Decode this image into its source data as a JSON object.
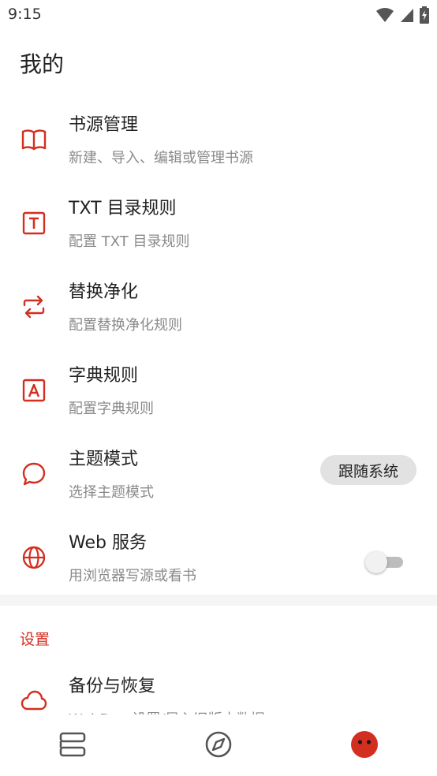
{
  "status_bar": {
    "time": "9:15"
  },
  "page": {
    "title": "我的"
  },
  "items": [
    {
      "title": "书源管理",
      "subtitle": "新建、导入、编辑或管理书源"
    },
    {
      "title": "TXT 目录规则",
      "subtitle": "配置 TXT 目录规则"
    },
    {
      "title": "替换净化",
      "subtitle": "配置替换净化规则"
    },
    {
      "title": "字典规则",
      "subtitle": "配置字典规则"
    },
    {
      "title": "主题模式",
      "subtitle": "选择主题模式",
      "value": "跟随系统"
    },
    {
      "title": "Web 服务",
      "subtitle": "用浏览器写源或看书",
      "enabled": false
    }
  ],
  "settings": {
    "section_title": "设置",
    "backup": {
      "title": "备份与恢复",
      "subtitle": "WebDav 设置/导入旧版本数据"
    }
  },
  "theme": {
    "accent": "#d32f20",
    "text": "#222222",
    "subtext": "#8a8a8a"
  },
  "icons": {
    "item_icons": [
      "book-open-icon",
      "txt-box-icon",
      "swap-arrows-icon",
      "letter-a-box-icon",
      "chat-bubble-icon",
      "globe-icon"
    ],
    "backup_icon": "cloud-icon",
    "nav_icons": [
      "bookshelf-icon",
      "compass-icon",
      "profile-face-icon"
    ]
  }
}
